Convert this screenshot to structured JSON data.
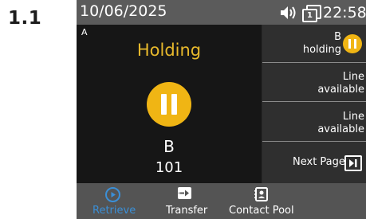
{
  "step_label": "1.1",
  "status_bar": {
    "date": "10/06/2025",
    "time": "22:58",
    "line_number": "1",
    "icons": [
      "speaker-volume-icon",
      "line-count-icon"
    ]
  },
  "call_pane": {
    "line_id": "A",
    "state": "Holding",
    "name": "B",
    "number": "101",
    "icon": "pause-icon"
  },
  "line_keys": [
    {
      "line1": "B",
      "line2": "holding",
      "icon": "pause-icon"
    },
    {
      "line1": "Line",
      "line2": "available"
    },
    {
      "line1": "Line",
      "line2": "available"
    }
  ],
  "next_page": {
    "label": "Next Page",
    "icon": "next-page-icon"
  },
  "softkeys": [
    {
      "label": "Retrieve",
      "icon": "play-circle-icon"
    },
    {
      "label": "Transfer",
      "icon": "transfer-arrow-icon"
    },
    {
      "label": "Contact Pool",
      "icon": "address-book-icon"
    }
  ],
  "colors": {
    "accent_hold": "#f0b514",
    "holding_text": "#e8b92c",
    "retrieve_blue": "#3b8fd6",
    "status_bar_bg": "#5b5b5b",
    "softkey_bg": "#545454"
  }
}
